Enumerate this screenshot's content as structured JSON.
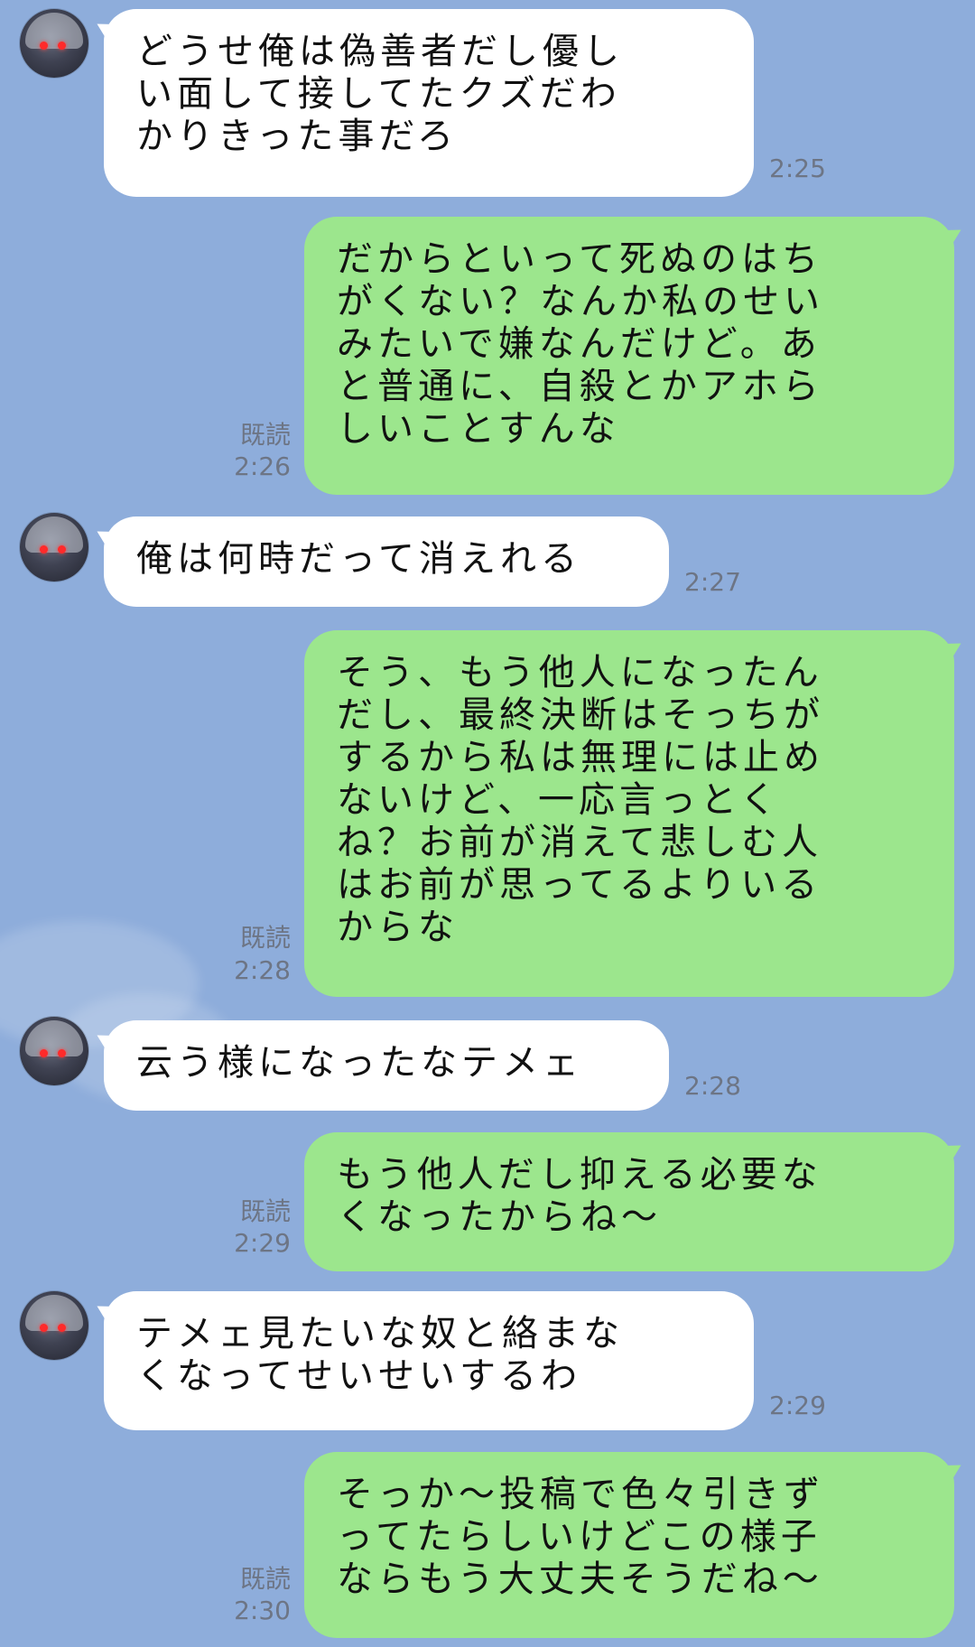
{
  "messages": [
    {
      "side": "in",
      "text": "どうせ俺は偽善者だし優し\nい面して接してたクズだわ\nかりきった事だろ",
      "time": "2:25"
    },
    {
      "side": "out",
      "text": "だからといって死ぬのはち\nがくない？なんか私のせい\nみたいで嫌なんだけど。あ\nと普通に、自殺とかアホら\nしいことすんな",
      "read": "既読",
      "time": "2:26"
    },
    {
      "side": "in",
      "text": "俺は何時だって消えれる",
      "time": "2:27"
    },
    {
      "side": "out",
      "text": "そう、もう他人になったん\nだし、最終決断はそっちが\nするから私は無理には止め\nないけど、一応言っとく\nね？お前が消えて悲しむ人\nはお前が思ってるよりいる\nからな",
      "read": "既読",
      "time": "2:28"
    },
    {
      "side": "in",
      "text": "云う様になったなテメェ",
      "time": "2:28"
    },
    {
      "side": "out",
      "text": "もう他人だし抑える必要な\nくなったからね〜",
      "read": "既読",
      "time": "2:29"
    },
    {
      "side": "in",
      "text": "テメェ見たいな奴と絡まな\nくなってせいせいするわ",
      "time": "2:29"
    },
    {
      "side": "out",
      "text": "そっか〜投稿で色々引きず\nってたらしいけどこの様子\nならもう大丈夫そうだね〜",
      "read": "既読",
      "time": "2:30"
    }
  ],
  "colors": {
    "background": "#8eaddb",
    "incoming": "#ffffff",
    "outgoing": "#9ce68d",
    "meta": "#6d7585"
  }
}
